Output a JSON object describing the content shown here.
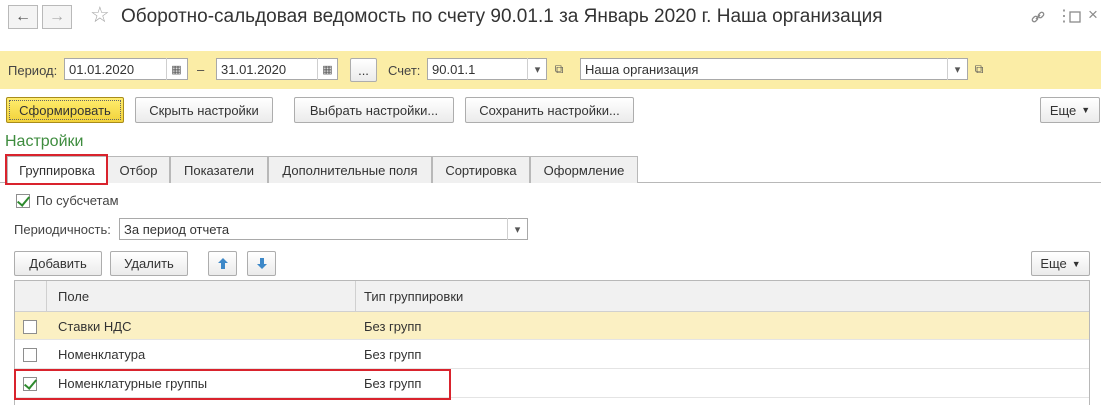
{
  "window": {
    "back_icon": "back-arrow-icon",
    "forward_icon": "forward-arrow-icon",
    "title": "Оборотно-сальдовая ведомость по счету 90.01.1 за Январь 2020 г. Наша организация",
    "favorite_icon": "star-icon",
    "toolbar_icons": [
      "link-icon",
      "more-vertical-icon",
      "maximize-icon",
      "close-icon"
    ]
  },
  "period_panel": {
    "period_label": "Период:",
    "date_from": "01.01.2020",
    "dash": "–",
    "date_to": "31.01.2020",
    "ellipsis_label": "...",
    "account_label": "Счет:",
    "account": "90.01.1",
    "organization": "Наша организация"
  },
  "actions": {
    "generate": "Сформировать",
    "hide_settings": "Скрыть настройки",
    "choose_settings": "Выбрать настройки...",
    "save_settings": "Сохранить настройки...",
    "more": "Еще"
  },
  "settings": {
    "header": "Настройки",
    "tabs": [
      "Группировка",
      "Отбор",
      "Показатели",
      "Дополнительные поля",
      "Сортировка",
      "Оформление"
    ],
    "active_tab": "Группировка"
  },
  "grouping": {
    "by_subaccounts_label": "По субсчетам",
    "by_subaccounts_checked": true,
    "periodicity_label": "Периодичность:",
    "periodicity_value": "За период отчета",
    "add_button": "Добавить",
    "delete_button": "Удалить",
    "more_button": "Еще",
    "columns": [
      "Поле",
      "Тип группировки"
    ],
    "rows": [
      {
        "checked": false,
        "field": "Ставки НДС",
        "type": "Без групп",
        "selected": true
      },
      {
        "checked": false,
        "field": "Номенклатура",
        "type": "Без групп",
        "selected": false
      },
      {
        "checked": true,
        "field": "Номенклатурные группы",
        "type": "Без групп",
        "selected": false
      }
    ]
  },
  "colors": {
    "panel_bg": "#fbeda6",
    "primary_button": "#f7dc4a",
    "accent_green": "#3e8c3e",
    "highlight_red": "#d9232d",
    "selected_row": "#fbf0c3"
  }
}
